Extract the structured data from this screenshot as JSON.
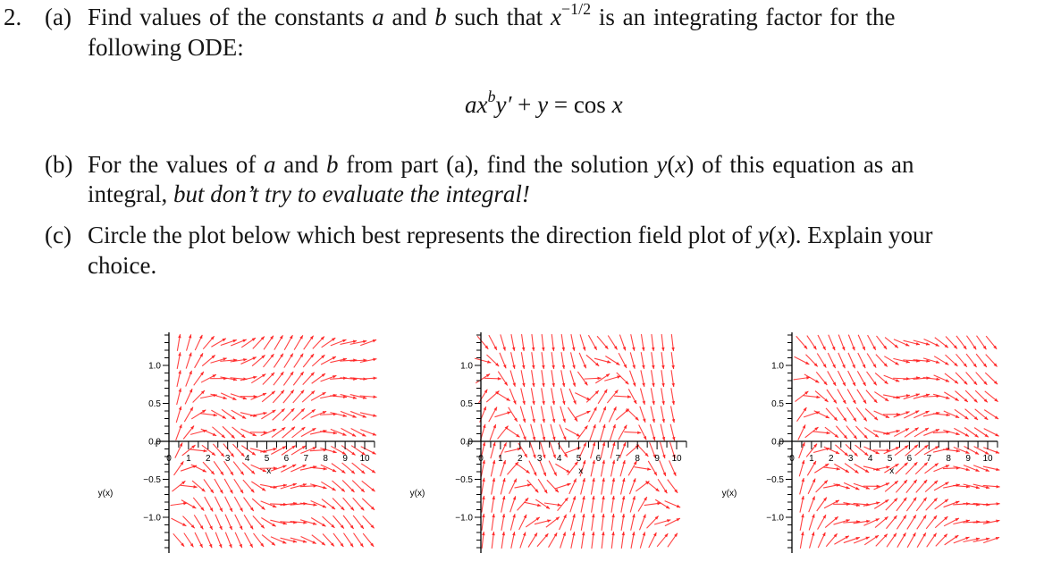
{
  "problem": {
    "number": "2.",
    "part_a": {
      "label": "(a)",
      "line1_pre": "Find values of the constants ",
      "var_a": "a",
      "and1": " and ",
      "var_b": "b",
      "line1_mid": " such that ",
      "factor_base": "x",
      "factor_exp": "−1/2",
      "line1_post": " is an integrating factor for the",
      "line2": "following ODE:",
      "equation": {
        "a": "a",
        "x": "x",
        "exp": "b",
        "yprime": "y′",
        "rest": " + ",
        "y": "y",
        "eq": " = ",
        "cos": "cos ",
        "x2": "x"
      }
    },
    "part_b": {
      "label": "(b)",
      "line1_pre": "For the values of ",
      "var_a": "a",
      "and1": " and ",
      "var_b": "b",
      "line1_mid": " from part (a), find the solution ",
      "func": "y",
      "paren_open": "(",
      "arg": "x",
      "paren_close": ")",
      "line1_post": " of this equation as an",
      "line2_pre": "integral, ",
      "line2_italic": "but don’t try to evaluate the integral!"
    },
    "part_c": {
      "label": "(c)",
      "line1_pre": "Circle the plot below which best represents the direction field plot of ",
      "func": "y",
      "paren_open": "(",
      "arg": "x",
      "paren_close": ")",
      "line1_post": ". Explain your",
      "line2": "choice."
    }
  },
  "chart_data": [
    {
      "type": "direction-field",
      "title": "",
      "xlabel": "x",
      "ylabel": "y(x)",
      "xlim": [
        0,
        10.3
      ],
      "ylim": [
        -1.4,
        1.4
      ],
      "xticks": [
        "0",
        "1",
        "2",
        "3",
        "4",
        "5",
        "6",
        "7",
        "8",
        "9",
        "10"
      ],
      "yticks": [
        "-1.0",
        "-0.5",
        "0.0",
        "0.5",
        "1.0"
      ],
      "ytick_values": [
        -1.0,
        -0.5,
        0.0,
        0.5,
        1.0
      ],
      "field": "y' = (y + cos x) / (2·√x)",
      "field_id": "plus_sqrt",
      "grid_x": {
        "start": 0.5,
        "step": 0.51,
        "count": 20
      },
      "grid_y": {
        "start": -1.3,
        "step": 0.2364,
        "count": 12
      },
      "arrow_color": "#ff2020"
    },
    {
      "type": "direction-field",
      "title": "",
      "xlabel": "x",
      "ylabel": "y(x)",
      "xlim": [
        0,
        10.3
      ],
      "ylim": [
        -1.4,
        1.4
      ],
      "xticks": [
        "0",
        "1",
        "2",
        "3",
        "4",
        "5",
        "6",
        "7",
        "8",
        "9",
        "10"
      ],
      "yticks": [
        "-1.0",
        "-0.5",
        "0.0",
        "0.5",
        "1.0"
      ],
      "ytick_values": [
        -1.0,
        -0.5,
        0.0,
        0.5,
        1.0
      ],
      "field": "y' = cos x − y",
      "field_id": "periodic",
      "grid_x": {
        "start": 0.1,
        "step": 0.51,
        "count": 20
      },
      "grid_y": {
        "start": -1.3,
        "step": 0.2364,
        "count": 12
      },
      "arrow_color": "#ff2020"
    },
    {
      "type": "direction-field",
      "title": "",
      "xlabel": "x",
      "ylabel": "y(x)",
      "xlim": [
        0,
        10.3
      ],
      "ylim": [
        -1.4,
        1.4
      ],
      "xticks": [
        "0",
        "1",
        "2",
        "3",
        "4",
        "5",
        "6",
        "7",
        "8",
        "9",
        "10"
      ],
      "yticks": [
        "-1.0",
        "-0.5",
        "0.0",
        "0.5",
        "1.0"
      ],
      "ytick_values": [
        -1.0,
        -0.5,
        0.0,
        0.5,
        1.0
      ],
      "field": "y' = (cos x − y) / (2·√x)",
      "field_id": "minus_sqrt",
      "grid_x": {
        "start": 0.5,
        "step": 0.51,
        "count": 20
      },
      "grid_y": {
        "start": -1.3,
        "step": 0.2364,
        "count": 12
      },
      "arrow_color": "#ff2020"
    }
  ]
}
